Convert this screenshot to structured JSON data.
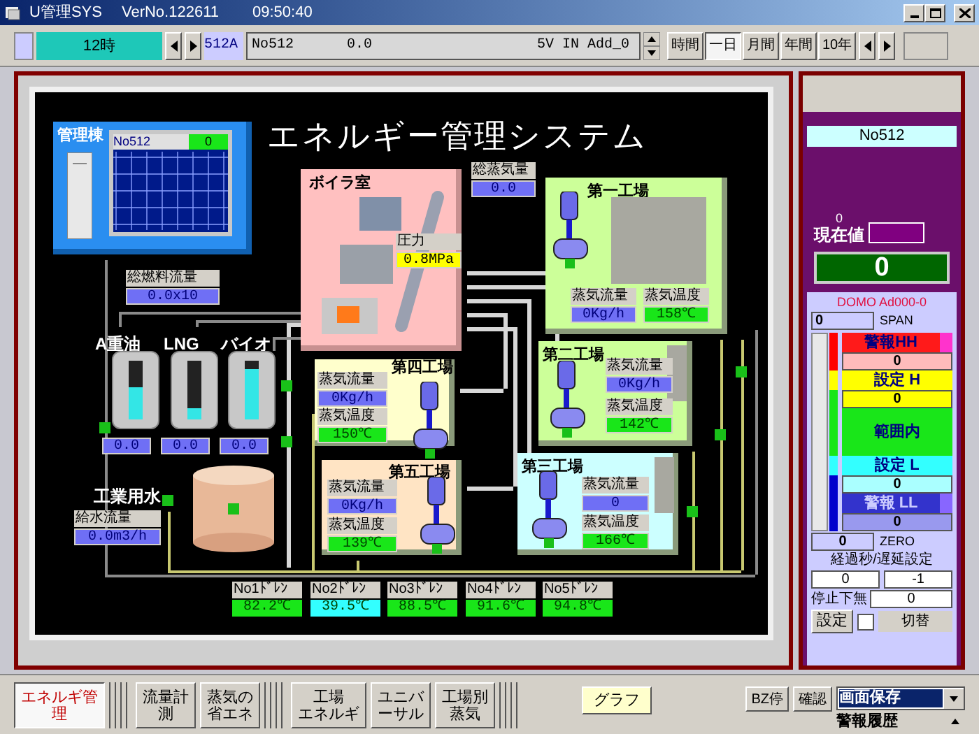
{
  "window": {
    "app": "U管理SYS",
    "version": "VerNo.122611",
    "time": "09:50:40"
  },
  "toolbar": {
    "period": "12時",
    "channel_tag": "512A",
    "channel": "No512",
    "value": "0.0",
    "input": "5V IN Add_0",
    "ranges": [
      {
        "label": "時間",
        "selected": false
      },
      {
        "label": "一日",
        "selected": true
      },
      {
        "label": "月間",
        "selected": false
      },
      {
        "label": "年間",
        "selected": false
      },
      {
        "label": "10年",
        "selected": false
      }
    ]
  },
  "diagram": {
    "title": "エネルギー管理システム",
    "monitor": {
      "label": "管理棟",
      "channel": "No512",
      "value": "0"
    },
    "total_fuel": {
      "label": "総燃料流量",
      "value": "0.0x10"
    },
    "tanks": [
      {
        "label": "A重油",
        "level": 0.55,
        "value": "0.0"
      },
      {
        "label": "LNG",
        "level": 0.2,
        "value": "0.0"
      },
      {
        "label": "バイオ",
        "level": 0.85,
        "value": "0.0"
      }
    ],
    "water": {
      "label": "工業用水",
      "flow_label": "給水流量",
      "flow_value": "0.0m3/h"
    },
    "boiler": {
      "label": "ボイラ室",
      "pressure_label": "圧力",
      "pressure_value": "0.8MPa"
    },
    "total_steam": {
      "label": "総蒸気量",
      "value": "0.0"
    },
    "factories": [
      {
        "name": "第一工場",
        "flow_label": "蒸気流量",
        "flow": "0Kg/h",
        "temp_label": "蒸気温度",
        "temp": "158℃"
      },
      {
        "name": "第二工場",
        "flow_label": "蒸気流量",
        "flow": "0Kg/h",
        "temp_label": "蒸気温度",
        "temp": "142℃"
      },
      {
        "name": "第三工場",
        "flow_label": "蒸気流量",
        "flow": "0",
        "temp_label": "蒸気温度",
        "temp": "166℃"
      },
      {
        "name": "第四工場",
        "flow_label": "蒸気流量",
        "flow": "0Kg/h",
        "temp_label": "蒸気温度",
        "temp": "150℃"
      },
      {
        "name": "第五工場",
        "flow_label": "蒸気流量",
        "flow": "0Kg/h",
        "temp_label": "蒸気温度",
        "temp": "139℃"
      }
    ],
    "drains": [
      {
        "label": "No1ﾄﾞﾚﾝ",
        "value": "82.2℃",
        "color": "#19e619"
      },
      {
        "label": "No2ﾄﾞﾚﾝ",
        "value": "39.5℃",
        "color": "#33ffff"
      },
      {
        "label": "No3ﾄﾞﾚﾝ",
        "value": "88.5℃",
        "color": "#19e619"
      },
      {
        "label": "No4ﾄﾞﾚﾝ",
        "value": "91.6℃",
        "color": "#19e619"
      },
      {
        "label": "No5ﾄﾞﾚﾝ",
        "value": "94.8℃",
        "color": "#19e619"
      }
    ]
  },
  "side_panel": {
    "channel": "No512",
    "current_small": "0",
    "current_label": "現在値",
    "current_value": "0",
    "device": "DOMO Ad000-0",
    "span_value": "0",
    "span_label": "SPAN",
    "hh_label": "警報HH",
    "hh_value": "0",
    "h_label": "設定 H",
    "h_value": "0",
    "range_label": "範囲内",
    "l_label": "設定 L",
    "l_value": "0",
    "ll_label": "警報 LL",
    "ll_value": "0",
    "zero_value": "0",
    "zero_label": "ZERO",
    "delay_title": "経過秒/遅延設定",
    "elapsed": "0",
    "delay": "-1",
    "stop_label": "停止下無",
    "stop_value": "0",
    "set_button": "設定",
    "switch_label": "切替",
    "switch_checked": false
  },
  "bottom": {
    "tabs": [
      {
        "lines": [
          "エネルギ管",
          "理"
        ],
        "selected": true
      },
      {
        "lines": [
          "流量計",
          "測"
        ],
        "selected": false
      },
      {
        "lines": [
          "蒸気の",
          "省エネ"
        ],
        "selected": false
      },
      {
        "lines": [
          "工場",
          "エネルギ"
        ],
        "selected": false
      },
      {
        "lines": [
          "ユニバ",
          "ーサル"
        ],
        "selected": false
      },
      {
        "lines": [
          "工場別",
          "蒸気"
        ],
        "selected": false
      }
    ],
    "graph_button": "グラフ",
    "buttons": [
      "BZ停",
      "確認"
    ],
    "save_select": "画面保存",
    "history": "警報履歴"
  }
}
